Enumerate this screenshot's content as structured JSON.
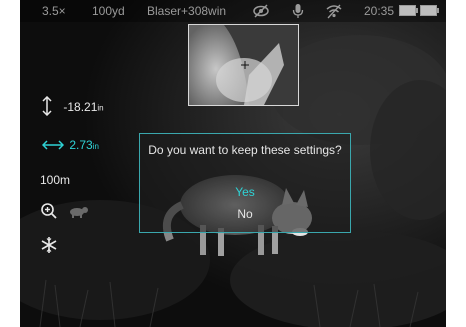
{
  "status_bar": {
    "zoom": "3.5×",
    "distance": "100yd",
    "profile": "Blaser+308win",
    "time": "20:35",
    "icons": [
      "eye-off-icon",
      "microphone-icon",
      "wifi-icon",
      "battery-icon"
    ]
  },
  "left_panel": {
    "vertical_offset_value": "-18.21",
    "vertical_offset_unit": "in",
    "horizontal_offset_value": "2.73",
    "horizontal_offset_unit": "in",
    "distance": "100m",
    "icons": [
      "vertical-arrows-icon",
      "horizontal-arrows-icon",
      "zoom-in-icon",
      "animal-icon",
      "snowflake-icon"
    ]
  },
  "dialog": {
    "message": "Do you want to keep these settings?",
    "yes_label": "Yes",
    "no_label": "No"
  },
  "colors": {
    "accent": "#2fd3d6",
    "dialog_border": "#3aa7ad",
    "text": "#e6e6e6"
  }
}
